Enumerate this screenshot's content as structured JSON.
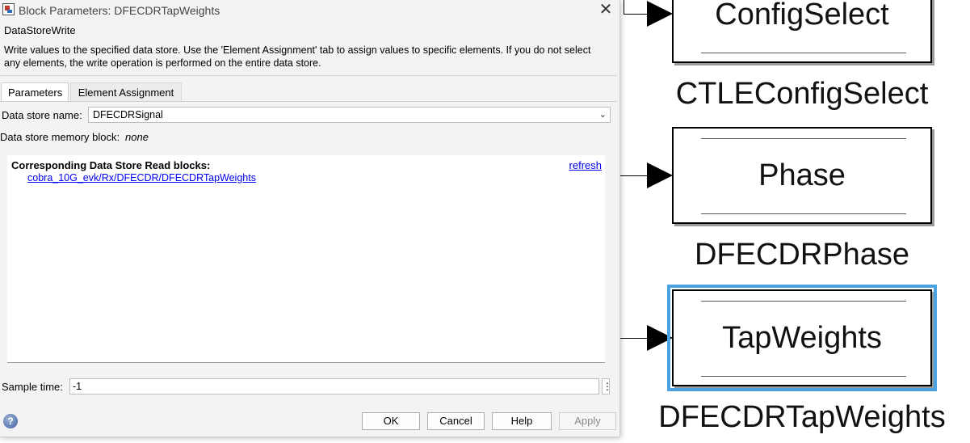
{
  "dialog": {
    "title": "Block Parameters: DFECDRTapWeights",
    "close_label": "✕",
    "block_type": "DataStoreWrite",
    "description": "Write values to the specified data store. Use the 'Element Assignment' tab to assign values to specific elements. If you do not select any elements, the write operation is performed on the entire data store.",
    "tabs": [
      {
        "label": "Parameters",
        "active": true
      },
      {
        "label": "Element Assignment",
        "active": false
      }
    ],
    "data_store_name": {
      "label": "Data store name:",
      "value": "DFECDRSignal"
    },
    "memory_block": {
      "label": "Data store memory block:",
      "value": "none"
    },
    "read_blocks": {
      "heading": "Corresponding Data Store Read blocks:",
      "refresh_label": "refresh",
      "links": [
        "cobra_10G_evk/Rx/DFECDR/DFECDRTapWeights"
      ]
    },
    "sample_time": {
      "label": "Sample time:",
      "value": "-1",
      "more_label": "⋮"
    },
    "buttons": {
      "ok": "OK",
      "cancel": "Cancel",
      "help": "Help",
      "apply": "Apply"
    },
    "help_icon_glyph": "?"
  },
  "canvas": {
    "blocks": [
      {
        "inner_label": "ConfigSelect",
        "name": "CTLEConfigSelect",
        "selected": false
      },
      {
        "inner_label": "Phase",
        "name": "DFECDRPhase",
        "selected": false
      },
      {
        "inner_label": "TapWeights",
        "name": "DFECDRTapWeights",
        "selected": true
      }
    ],
    "selection_color": "#4aa3e0"
  }
}
